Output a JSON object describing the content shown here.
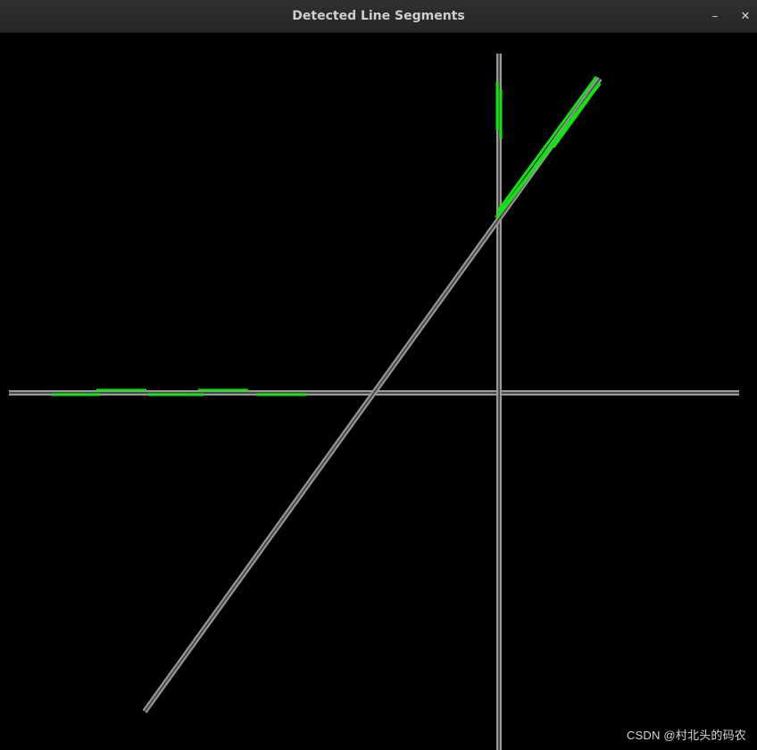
{
  "window": {
    "title": "Detected Line Segments",
    "minimize_label": "–",
    "close_label": "✕"
  },
  "canvas": {
    "background_color": "#000000",
    "line_color": "#b8b8b8",
    "segment_color": "#18e018"
  },
  "watermark": {
    "text": "CSDN @村北头的码农"
  }
}
